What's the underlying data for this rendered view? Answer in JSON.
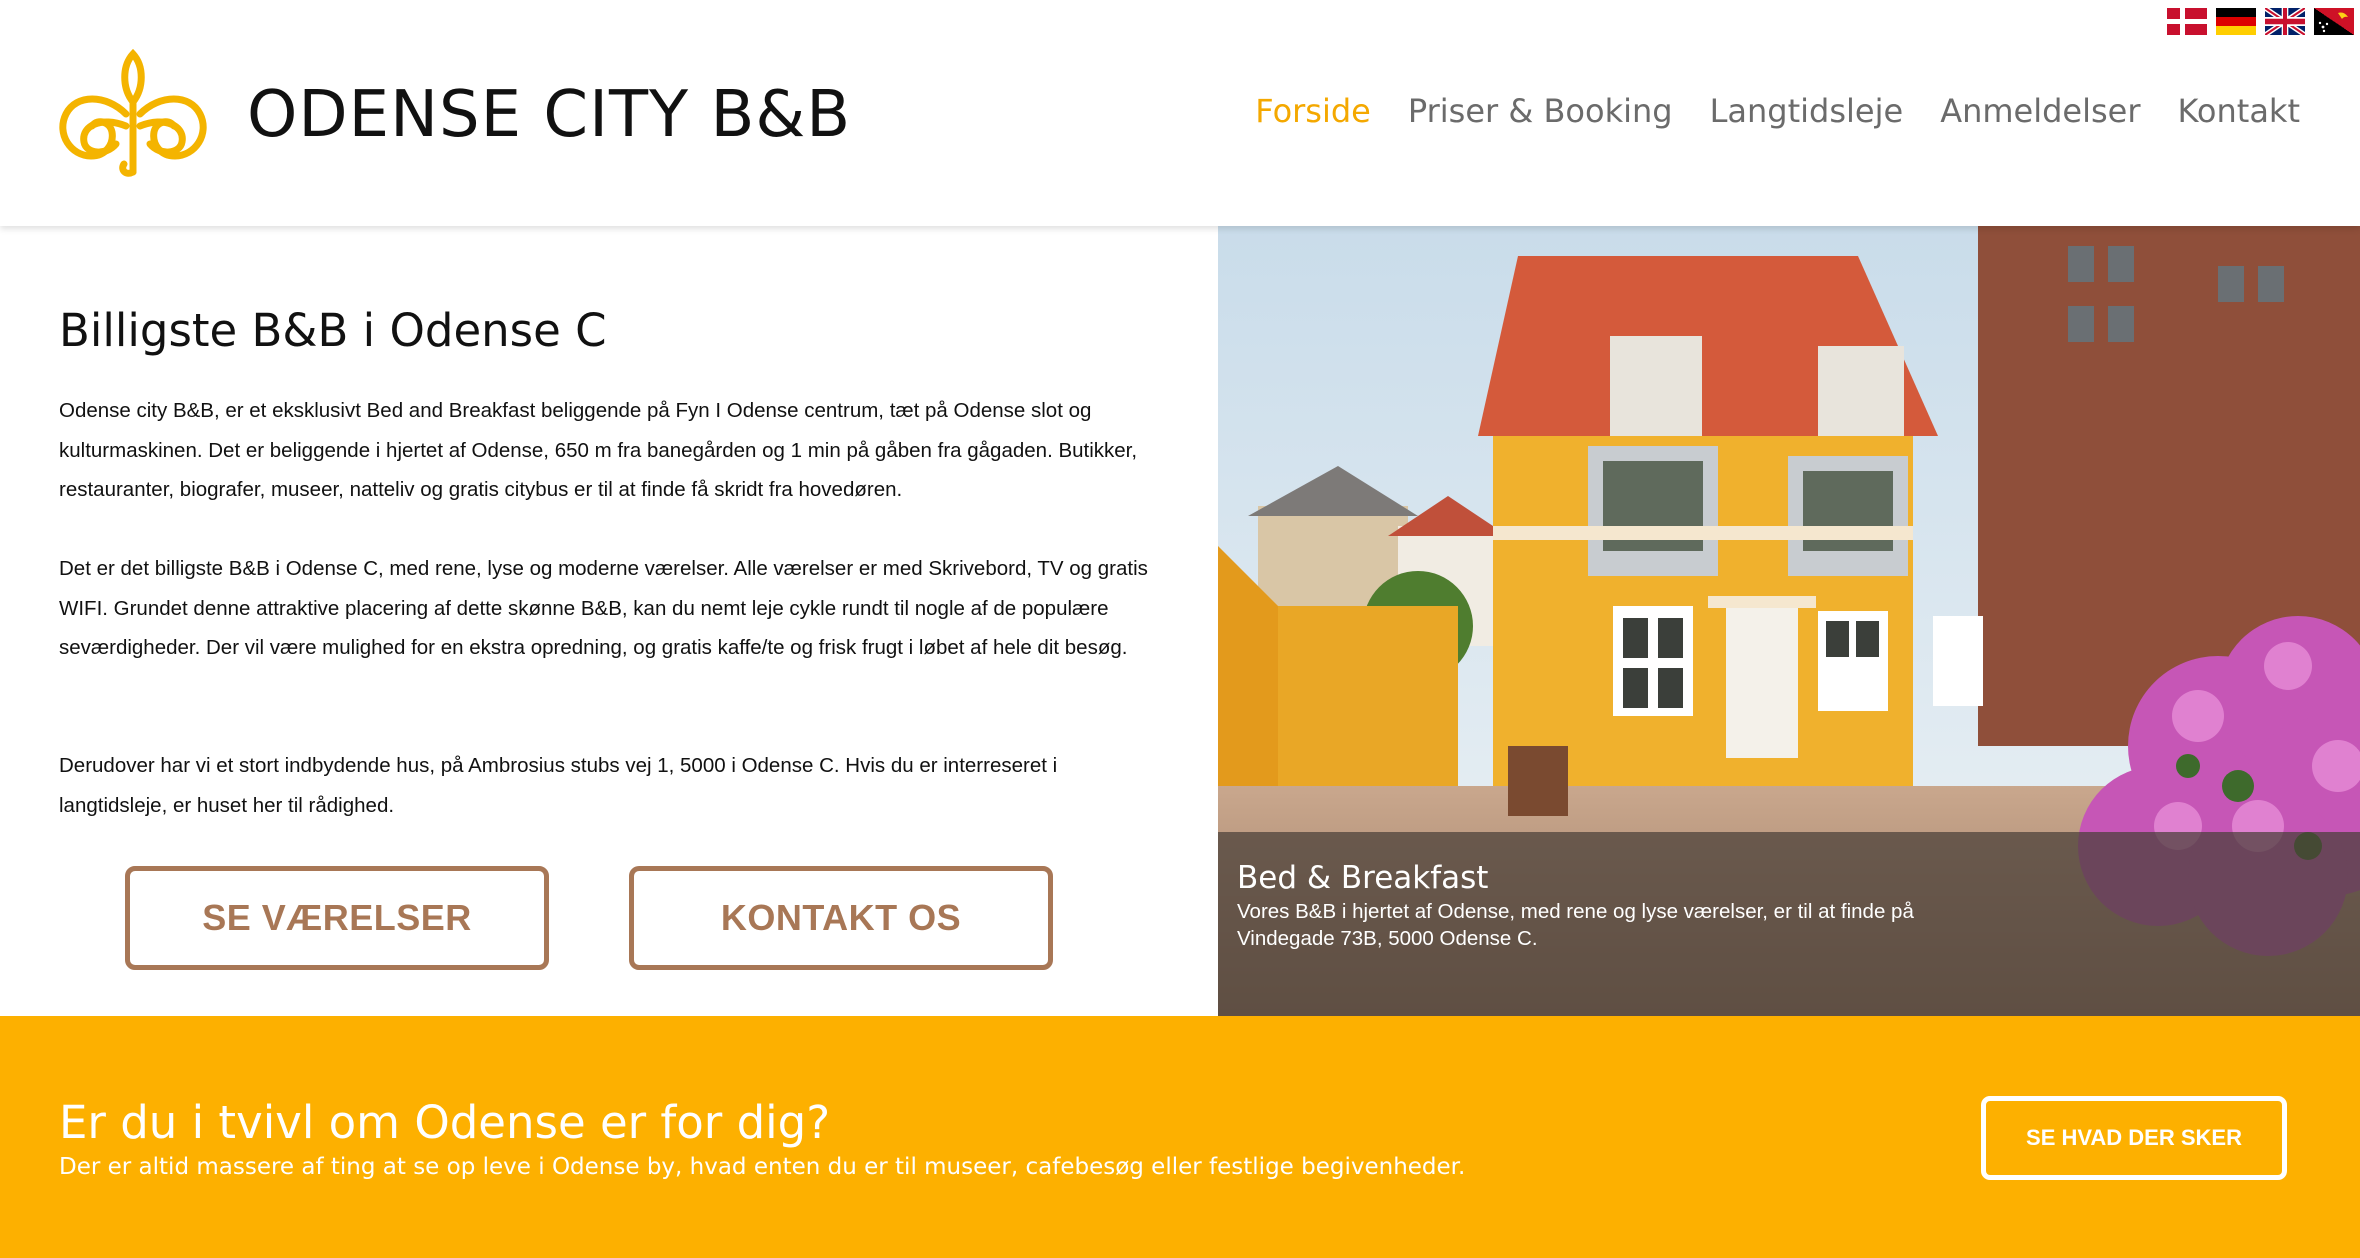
{
  "header": {
    "brand": "ODENSE CITY B&B",
    "logo_icon": "bb-monogram-logo",
    "logo_color": "#f4b400",
    "languages": [
      {
        "code": "da",
        "icon": "denmark-flag-icon"
      },
      {
        "code": "de",
        "icon": "germany-flag-icon"
      },
      {
        "code": "en",
        "icon": "uk-flag-icon"
      },
      {
        "code": "pg",
        "icon": "papua-new-guinea-flag-icon"
      }
    ],
    "nav": [
      {
        "label": "Forside",
        "active": true
      },
      {
        "label": "Priser & Booking",
        "active": false
      },
      {
        "label": "Langtidsleje",
        "active": false
      },
      {
        "label": "Anmeldelser",
        "active": false
      },
      {
        "label": "Kontakt",
        "active": false
      }
    ]
  },
  "intro": {
    "title": "Billigste B&B i Odense C",
    "paragraphs": [
      "Odense city B&B, er et eksklusivt Bed and Breakfast beliggende på Fyn I Odense centrum, tæt på Odense slot og kulturmaskinen. Det er beliggende i hjertet af Odense, 650 m fra banegården og 1 min på gåben fra gågaden. Butikker, restauranter, biografer, museer, natteliv og gratis citybus er til at finde få skridt fra hovedøren.",
      "Det er det billigste B&B i Odense C, med rene, lyse og moderne værelser. Alle værelser er med Skrivebord, TV og gratis WIFI. Grundet denne attraktive placering af dette skønne B&B, kan du nemt leje cykle rundt til nogle af de populære seværdigheder. Der vil være mulighed for en ekstra opredning, og gratis kaffe/te og frisk frugt i løbet af hele dit besøg.",
      "Derudover har vi et stort indbydende hus, på Ambrosius stubs vej 1, 5000 i Odense C. Hvis du er interreseret i langtidsleje, er huset her til rådighed."
    ],
    "buttons": {
      "rooms": "SE VÆRELSER",
      "contact": "KONTAKT OS"
    },
    "button_color": "#a87756"
  },
  "hero": {
    "caption_title": "Bed & Breakfast",
    "caption_text": "Vores B&B i hjertet af Odense, med rene og lyse værelser, er til at finde på Vindegade 73B, 5000 Odense C."
  },
  "band": {
    "title": "Er du i tvivl om Odense er for dig?",
    "text": "Der er altid massere af ting at se op leve i Odense by, hvad enten du er til museer, cafebesøg eller festlige begivenheder.",
    "button": "SE HVAD DER SKER",
    "background": "#fdb000"
  }
}
